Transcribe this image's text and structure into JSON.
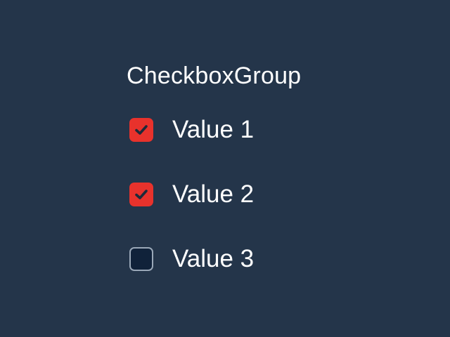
{
  "checkbox_group": {
    "title": "CheckboxGroup",
    "items": [
      {
        "label": "Value 1",
        "checked": true
      },
      {
        "label": "Value 2",
        "checked": true
      },
      {
        "label": "Value 3",
        "checked": false
      }
    ]
  },
  "colors": {
    "background": "#24354a",
    "checked_fill": "#e8322c",
    "check_mark": "#1d2a3a",
    "unchecked_fill": "#10223a",
    "unchecked_border": "#9aa8b8",
    "text": "#ffffff"
  }
}
